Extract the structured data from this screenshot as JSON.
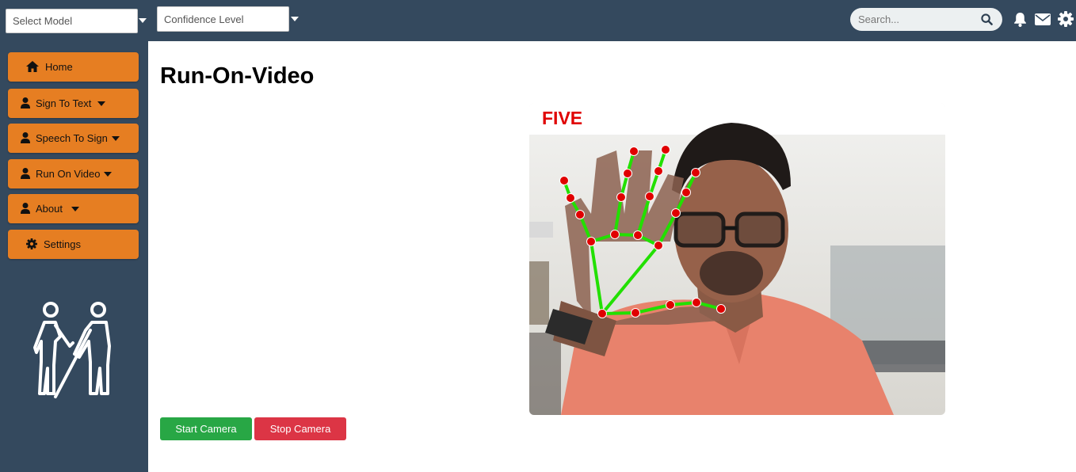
{
  "header": {
    "model_select": "Select Model",
    "confidence_select": "Confidence Level",
    "search_placeholder": "Search..."
  },
  "sidebar": {
    "items": [
      {
        "label": "Home",
        "icon": "home-icon",
        "dropdown": false
      },
      {
        "label": "Sign To Text",
        "icon": "user-icon",
        "dropdown": true
      },
      {
        "label": "Speech To Sign",
        "icon": "user-icon",
        "dropdown": true
      },
      {
        "label": "Run On Video",
        "icon": "user-icon",
        "dropdown": true
      },
      {
        "label": "About",
        "icon": "user-icon",
        "dropdown": true
      },
      {
        "label": "Settings",
        "icon": "gear-icon",
        "dropdown": false
      }
    ]
  },
  "main": {
    "title": "Run-On-Video",
    "prediction_label": "FIVE",
    "start_button": "Start Camera",
    "stop_button": "Stop Camera"
  },
  "colors": {
    "topbar": "#34495e",
    "nav_button": "#e67e22",
    "start": "#28a745",
    "stop": "#dc3545",
    "landmark": "#e00000",
    "skeleton": "#22e000"
  }
}
